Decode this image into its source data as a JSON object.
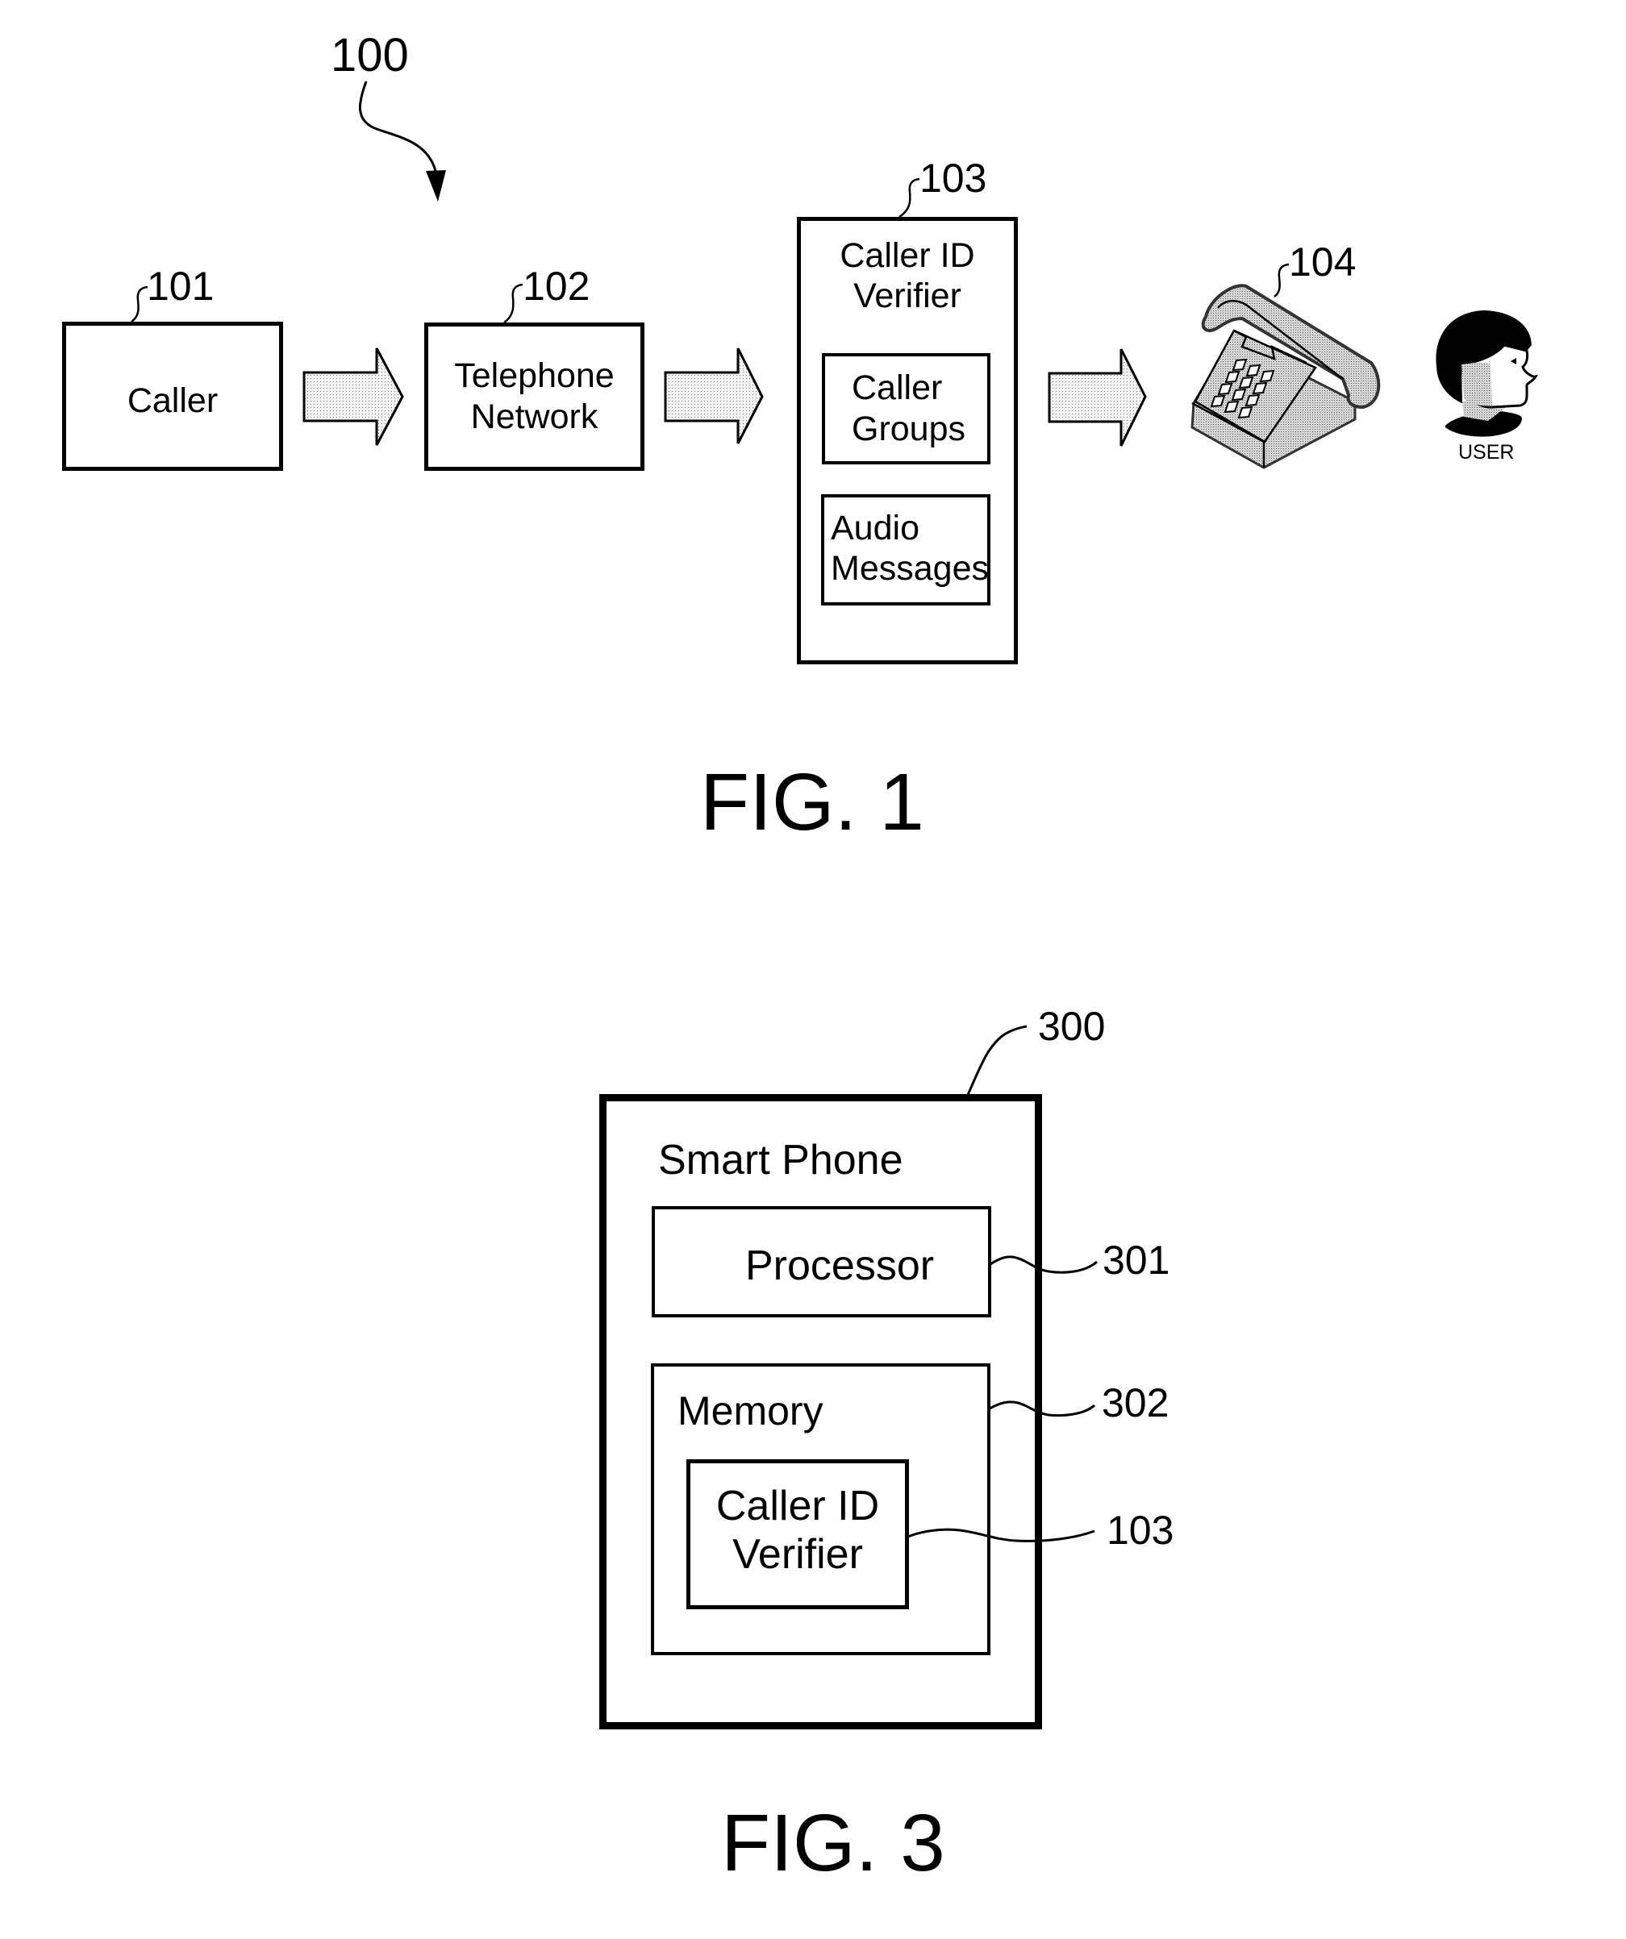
{
  "fig1": {
    "ref_overall": "100",
    "caller": {
      "ref": "101",
      "label": "Caller"
    },
    "network": {
      "ref": "102",
      "line1": "Telephone",
      "line2": "Network"
    },
    "verifier": {
      "ref": "103",
      "line1": "Caller ID",
      "line2": "Verifier",
      "groups": {
        "line1": "Caller",
        "line2": "Groups"
      },
      "audio": {
        "line1": "Audio",
        "line2": "Messages"
      }
    },
    "phone": {
      "ref": "104",
      "icon": "telephone-icon"
    },
    "user": {
      "label": "USER",
      "icon": "user-head-icon"
    },
    "caption": "FIG. 1"
  },
  "fig3": {
    "smartphone": {
      "ref": "300",
      "label": "Smart Phone"
    },
    "processor": {
      "ref": "301",
      "label": "Processor"
    },
    "memory": {
      "ref": "302",
      "label": "Memory"
    },
    "verifier": {
      "ref": "103",
      "line1": "Caller ID",
      "line2": "Verifier"
    },
    "caption": "FIG. 3"
  },
  "colors": {
    "ink": "#000000",
    "arrow_fill": "#e4e4e4",
    "phone_fill": "#c8c8c8",
    "paper": "#ffffff"
  }
}
